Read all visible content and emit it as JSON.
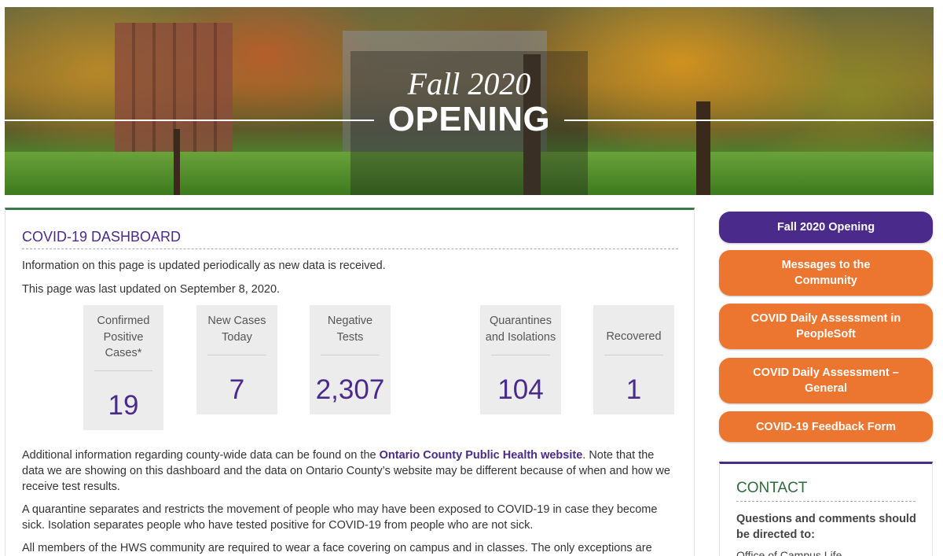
{
  "banner": {
    "script_text": "Fall 2020",
    "headline": "OPENING"
  },
  "dashboard": {
    "title": "COVID-19 DASHBOARD",
    "info_line": "Information on this page is updated periodically as new data is received.",
    "updated_line": "This page was last updated on September 8, 2020.",
    "stats": [
      {
        "label": "Confirmed Positive Cases*",
        "value": "19"
      },
      {
        "label": "New Cases Today",
        "value": "7"
      },
      {
        "label": "Negative Tests",
        "value": "2,307"
      },
      {
        "label": "Quarantines and Isolations",
        "value": "104"
      },
      {
        "label": "Recovered",
        "value": "1"
      }
    ],
    "additional_info_before": "Additional information regarding county-wide data can be found on the ",
    "additional_info_link": "Ontario County Public Health website",
    "additional_info_after": ". Note that the data we are showing on this dashboard and the data on Ontario County’s website may be different because of when and how we receive test results.",
    "quarantine_text": "A quarantine separates and restricts the movement of people who may have been exposed to COVID-19 in case they become sick. Isolation separates people who have tested positive for COVID-19 from people who are not sick.",
    "face_covering_text": "All members of the HWS community are required to wear a face covering on campus and in classes. The only exceptions are"
  },
  "sidebar": {
    "buttons": [
      {
        "label": "Fall 2020 Opening"
      },
      {
        "label": "Messages to the Community"
      },
      {
        "label": "COVID Daily Assessment in PeopleSoft"
      },
      {
        "label": "COVID Daily Assessment – General"
      },
      {
        "label": "COVID-19 Feedback Form"
      }
    ],
    "contact": {
      "title": "CONTACT",
      "text": "Questions and comments should be directed to:",
      "office": "Office of Campus Life"
    }
  },
  "colors": {
    "purple": "#4a2a8a",
    "orange": "#ec7630",
    "green": "#3d7a4a"
  }
}
